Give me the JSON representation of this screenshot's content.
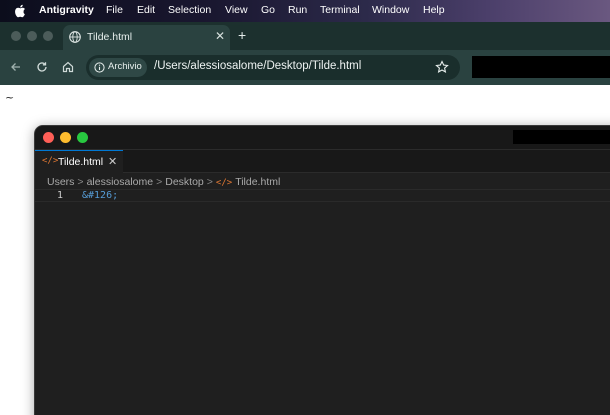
{
  "menubar": {
    "app_name": "Antigravity",
    "items": [
      "File",
      "Edit",
      "Selection",
      "View",
      "Go",
      "Run",
      "Terminal",
      "Window",
      "Help"
    ]
  },
  "browser": {
    "tab_title": "Tilde.html",
    "tab_close": "✕",
    "new_tab": "+",
    "site_info_label": "Archivio",
    "url": "/Users/alessiosalome/Desktop/Tilde.html"
  },
  "page": {
    "content": "~"
  },
  "editor": {
    "tab_icon": "</>",
    "tab_name": "Tilde.html",
    "tab_close": "✕",
    "breadcrumbs": [
      "Users",
      "alessiosalome",
      "Desktop"
    ],
    "breadcrumb_file": "Tilde.html",
    "breadcrumb_separator": ">",
    "line_number": "1",
    "code_line": "&#126;"
  },
  "colors": {
    "browser_frame": "#1d3331",
    "editor_bg": "#1f1f1f",
    "html_icon": "#e37933",
    "code_entity": "#569cd6",
    "close": "#ff5f57",
    "minimize": "#febc2e",
    "maximize": "#28c840"
  }
}
